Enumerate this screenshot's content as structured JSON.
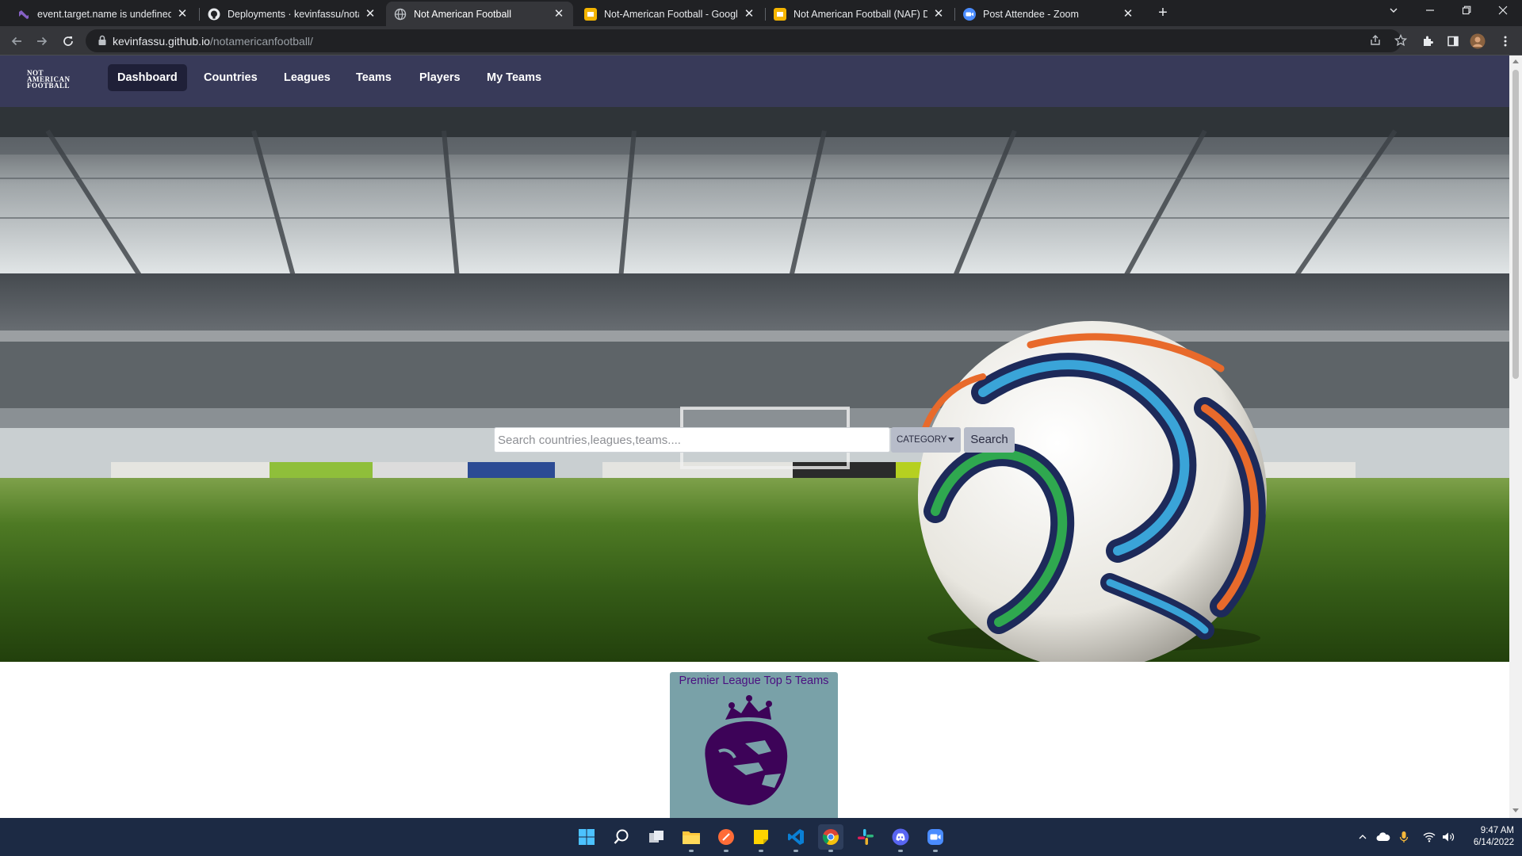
{
  "browser": {
    "tabs": [
      {
        "title": "event.target.name is undefined: V",
        "favicon": "visual-studio-icon",
        "active": false
      },
      {
        "title": "Deployments · kevinfassu/notam",
        "favicon": "github-icon",
        "active": false
      },
      {
        "title": "Not American Football",
        "favicon": "globe-icon",
        "active": true
      },
      {
        "title": "Not-American Football - Google",
        "favicon": "google-slides-icon",
        "active": false
      },
      {
        "title": "Not American Football (NAF) Dat",
        "favicon": "google-slides-icon",
        "active": false
      },
      {
        "title": "Post Attendee - Zoom",
        "favicon": "zoom-icon",
        "active": false
      }
    ],
    "new_tab": "+",
    "url_host": "kevinfassu.github.io",
    "url_path": "/notamericanfootball/"
  },
  "app": {
    "logo_lines": [
      "NOT",
      "AMERICAN",
      "FOOTBALL"
    ],
    "nav": [
      {
        "label": "Dashboard",
        "active": true
      },
      {
        "label": "Countries",
        "active": false
      },
      {
        "label": "Leagues",
        "active": false
      },
      {
        "label": "Teams",
        "active": false
      },
      {
        "label": "Players",
        "active": false
      },
      {
        "label": "My Teams",
        "active": false
      }
    ],
    "search": {
      "placeholder": "Search countries,leagues,teams....",
      "value": "",
      "category_label": "CATEGORY",
      "button_label": "Search"
    },
    "card": {
      "title": "Premier League Top 5 Teams",
      "image": "premier-league-lion-icon"
    }
  },
  "taskbar": {
    "apps": [
      "windows-start-icon",
      "search-icon",
      "task-view-icon",
      "file-explorer-icon",
      "postman-icon",
      "sticky-notes-icon",
      "vscode-icon",
      "chrome-icon",
      "slack-icon",
      "discord-icon",
      "zoom-icon"
    ],
    "time": "9:47 AM",
    "date": "6/14/2022"
  },
  "colors": {
    "app_nav_bg": "#383a59",
    "card_bg": "#79a1a8",
    "card_title": "#4b1080",
    "browser_bg": "#202124",
    "taskbar_bg": "#1c2a44"
  }
}
